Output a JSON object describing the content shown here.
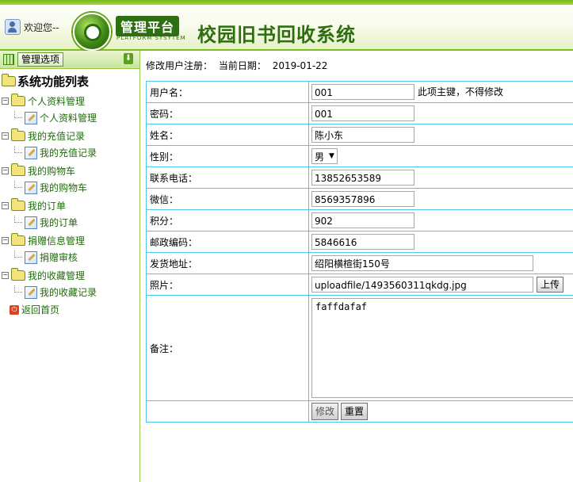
{
  "header": {
    "welcome": "欢迎您--",
    "platform_badge": "管理平台",
    "platform_sub": "PLATFORM SYSYTEM",
    "title": "校园旧书回收系统"
  },
  "sidebar": {
    "menu_button": "管理选项",
    "tree_title": "系统功能列表",
    "groups": [
      {
        "label": "个人资料管理",
        "child": "个人资料管理"
      },
      {
        "label": "我的充值记录",
        "child": "我的充值记录"
      },
      {
        "label": "我的购物车",
        "child": "我的购物车"
      },
      {
        "label": "我的订单",
        "child": "我的订单"
      },
      {
        "label": "捐赠信息管理",
        "child": "捐赠审核"
      },
      {
        "label": "我的收藏管理",
        "child": "我的收藏记录"
      }
    ],
    "back_home": "返回首页"
  },
  "main": {
    "breadcrumb": "修改用户注册：",
    "date_label": "当前日期：",
    "date_value": "2019-01-22",
    "fields": {
      "username_label": "用户名：",
      "username_value": "001",
      "username_note": "此项主键，不得修改",
      "password_label": "密码：",
      "password_value": "001",
      "name_label": "姓名：",
      "name_value": "陈小东",
      "gender_label": "性别：",
      "gender_value": "男",
      "phone_label": "联系电话：",
      "phone_value": "13852653589",
      "wechat_label": "微信：",
      "wechat_value": "8569357896",
      "points_label": "积分：",
      "points_value": "902",
      "postcode_label": "邮政编码：",
      "postcode_value": "5846616",
      "address_label": "发货地址：",
      "address_value": "绍阳横楦街150号",
      "photo_label": "照片：",
      "photo_value": "uploadfile/1493560311qkdg.jpg",
      "upload_button": "上传",
      "remark_label": "备注：",
      "remark_value": "faffdafaf"
    },
    "buttons": {
      "modify": "修改",
      "reset": "重置"
    }
  }
}
